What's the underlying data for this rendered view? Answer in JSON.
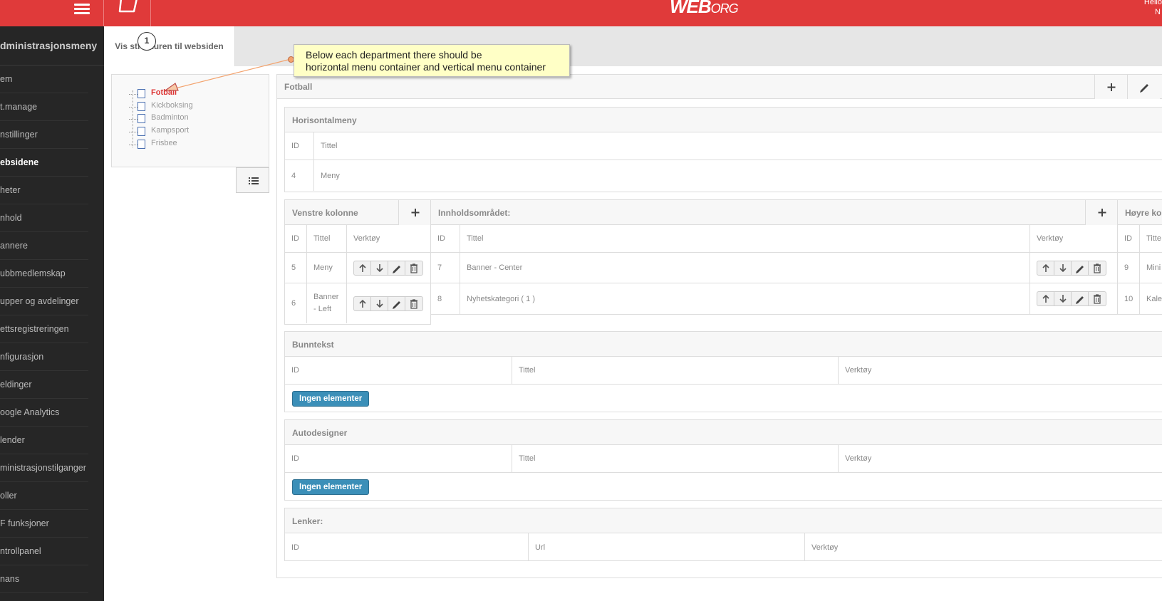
{
  "header": {
    "logo": "WEB",
    "logo_suffix": "ORG",
    "user_line1": "Hello",
    "user_line2": "N"
  },
  "sidebar": {
    "title": "dministrasjonsmeny",
    "items": [
      {
        "label": "em"
      },
      {
        "label": "t.manage"
      },
      {
        "label": "nstillinger"
      },
      {
        "label": "ebsidene",
        "active": true
      },
      {
        "label": "heter"
      },
      {
        "label": "nhold"
      },
      {
        "label": "annere"
      },
      {
        "label": "ubbmedlemskap"
      },
      {
        "label": "upper og avdelinger"
      },
      {
        "label": "ettsregistreringen"
      },
      {
        "label": "nfigurasjon"
      },
      {
        "label": "eldinger"
      },
      {
        "label": "oogle Analytics"
      },
      {
        "label": "lender"
      },
      {
        "label": "ministrasjonstilganger"
      },
      {
        "label": "oller"
      },
      {
        "label": "F funksjoner"
      },
      {
        "label": "ntrollpanel"
      },
      {
        "label": "nans"
      }
    ]
  },
  "tab": {
    "label": "Vis strukturen til websiden"
  },
  "annotation": {
    "number": "1",
    "line1": "Below each department there should be",
    "line2": "horizontal menu container and vertical menu container"
  },
  "tree": {
    "items": [
      "Fotball",
      "Kickboksing",
      "Badminton",
      "Kampsport",
      "Frisbee"
    ]
  },
  "main": {
    "title": "Fotball"
  },
  "horisontal": {
    "title": "Horisontalmeny",
    "col_id": "ID",
    "col_title": "Tittel",
    "rows": [
      {
        "id": "4",
        "title": "Meny"
      }
    ]
  },
  "venstre": {
    "title": "Venstre kolonne",
    "col_id": "ID",
    "col_title": "Tittel",
    "col_tools": "Verktøy",
    "rows": [
      {
        "id": "5",
        "title": "Meny"
      },
      {
        "id": "6",
        "title": "Banner - Left"
      }
    ]
  },
  "innhold": {
    "title": "Innholdsområdet:",
    "col_id": "ID",
    "col_title": "Tittel",
    "col_tools": "Verktøy",
    "rows": [
      {
        "id": "7",
        "title": "Banner - Center"
      },
      {
        "id": "8",
        "title": "Nyhetskategori ( 1 )"
      }
    ]
  },
  "hoyre": {
    "title": "Høyre kol",
    "col_id": "ID",
    "col_title": "Titte",
    "rows": [
      {
        "id": "9",
        "title": "Mini"
      },
      {
        "id": "10",
        "title": "Kale"
      }
    ]
  },
  "bunntekst": {
    "title": "Bunntekst",
    "col_id": "ID",
    "col_title": "Tittel",
    "col_tools": "Verktøy",
    "empty": "Ingen elementer"
  },
  "autodesigner": {
    "title": "Autodesigner",
    "col_id": "ID",
    "col_title": "Tittel",
    "col_tools": "Verktøy",
    "empty": "Ingen elementer"
  },
  "lenker": {
    "title": "Lenker:",
    "col_id": "ID",
    "col_url": "Url",
    "col_tools": "Verktøy"
  },
  "colors": {
    "brand": "#e03a3a",
    "sidebar": "#262626",
    "primary_button": "#3b8fb8",
    "active_tree": "#dd3333",
    "tooltip": "#ffffc6"
  }
}
